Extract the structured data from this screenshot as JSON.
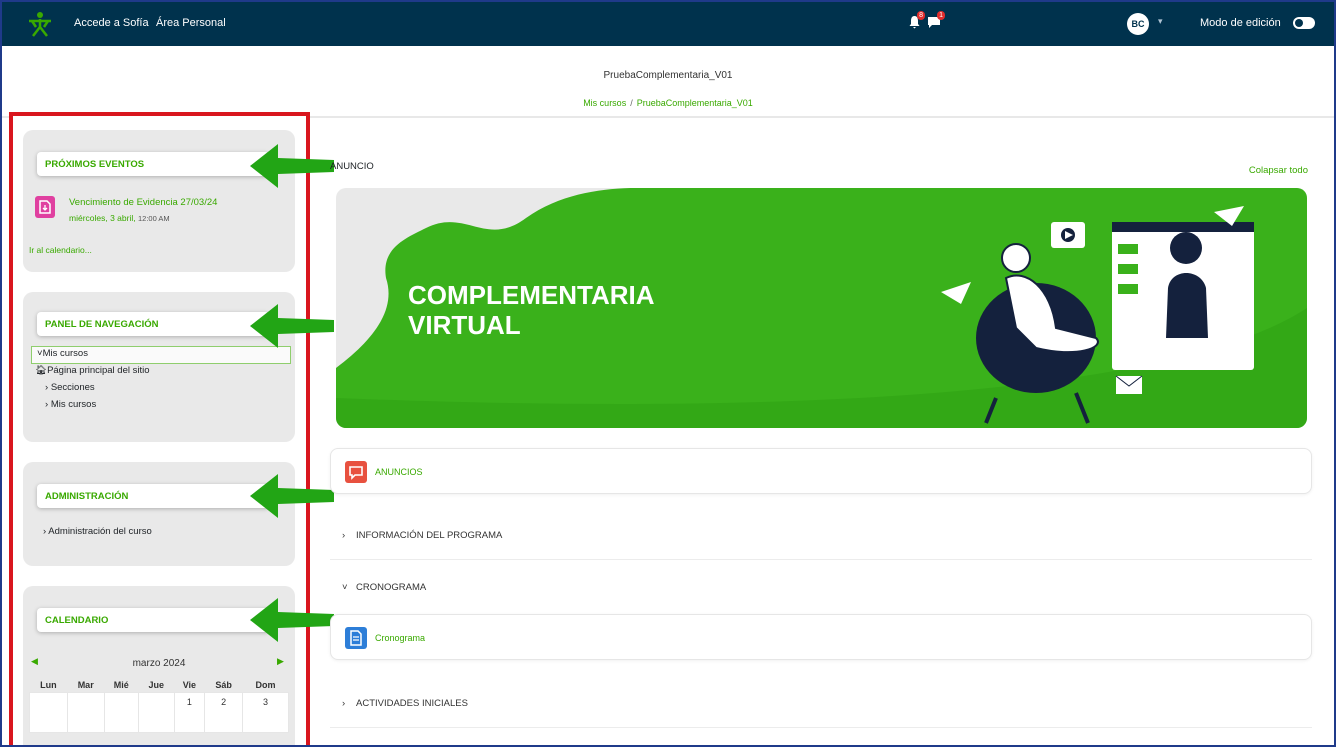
{
  "topbar": {
    "nav_links": [
      "Accede a Sofía",
      "Área Personal"
    ],
    "notifications_count": "8",
    "messages_count": "1",
    "avatar_initials": "BC",
    "edit_mode_label": "Modo de edición"
  },
  "header": {
    "course_title": "PruebaComplementaria_V01",
    "breadcrumb": [
      "Mis cursos",
      "PruebaComplementaria_V01"
    ]
  },
  "sidebar": {
    "events": {
      "title": "PRÓXIMOS EVENTOS",
      "event_name": "Vencimiento de Evidencia 27/03/24",
      "event_date": "miércoles, 3 abril,",
      "event_time": "12:00 AM",
      "calendar_link": "Ir al calendario..."
    },
    "navigation": {
      "title": "PANEL DE NAVEGACIÓN",
      "items": [
        "Mis cursos",
        "Página principal del sitio",
        "Secciones",
        "Mis cursos"
      ]
    },
    "administration": {
      "title": "ADMINISTRACIÓN",
      "item": "Administración del curso"
    },
    "calendar": {
      "title": "CALENDARIO",
      "month": "marzo 2024",
      "weekdays": [
        "Lun",
        "Mar",
        "Mié",
        "Jue",
        "Vie",
        "Sáb",
        "Dom"
      ],
      "first_week": [
        "",
        "",
        "",
        "",
        "1",
        "2",
        "3"
      ]
    }
  },
  "main": {
    "announcement_label": "ANUNCIO",
    "collapse_all": "Colapsar todo",
    "banner_title_line1": "COMPLEMENTARIA",
    "banner_title_line2": "VIRTUAL",
    "announcements_card": "ANUNCIOS",
    "sections": [
      "INFORMACIÓN DEL PROGRAMA",
      "CRONOGRAMA",
      "ACTIVIDADES INICIALES"
    ],
    "schedule_card": "Cronograma"
  },
  "colors": {
    "accent_green": "#39a900",
    "navbar": "#00324d",
    "highlight_red": "#d9161e",
    "arrow_green": "#22a515"
  }
}
